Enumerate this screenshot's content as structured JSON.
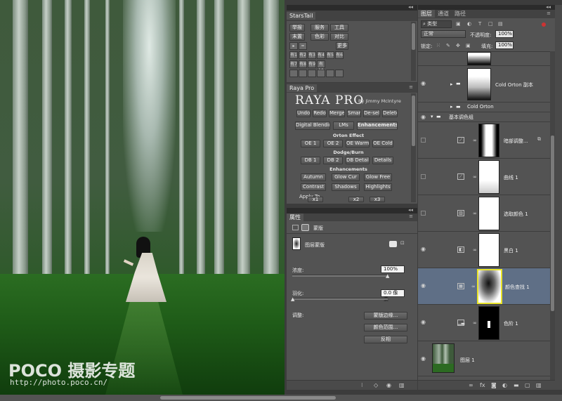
{
  "photo": {
    "watermark_logo": "POCO 摄影专题",
    "watermark_url": "http://photo.poco.cn/"
  },
  "starstail": {
    "title": "StarsTail",
    "row1": [
      "举报",
      "服务",
      "工具"
    ],
    "row2": [
      "末置",
      "色彩",
      "对比"
    ],
    "row3_more": "更多",
    "grid_labels": [
      "有1",
      "有2",
      "有3",
      "有4",
      "有5",
      "有6",
      "有7",
      "有8",
      "有9",
      "有10"
    ]
  },
  "raya": {
    "title": "Raya Pro",
    "logo": "RAYA PRO",
    "byline": "By Jimmy McIntyre",
    "row1": [
      "Undo",
      "Redo",
      "Merge",
      "Smart",
      "De-sel",
      "Delete"
    ],
    "tabs": [
      "Digital Blending",
      "LMs",
      "Enhancements"
    ],
    "section_orton": "Orton Effect",
    "orton_buttons": [
      "OE 1",
      "OE 2",
      "OE Warm",
      "OE Cold"
    ],
    "section_dodge": "Dodge/Burn",
    "dodge_buttons": [
      "DB 1",
      "DB 2",
      "DB Details",
      "Details"
    ],
    "section_enh": "Enhancements",
    "enh_row1": [
      "Autumn",
      "Glow Cur",
      "Glow Free"
    ],
    "enh_row2": [
      "Contrast",
      "Shadows",
      "Highlights"
    ],
    "apply_to": "Apply To",
    "apply_row": [
      "x1",
      "x2",
      "x3"
    ]
  },
  "properties": {
    "tab": "属性",
    "mask_type": "蒙版",
    "mask_label": "图层蒙版",
    "density_label": "浓度:",
    "density_value": "100%",
    "density_level": 1.0,
    "feather_label": "羽化:",
    "feather_value": "0.0 像素",
    "feather_level": 0.0,
    "refine_label": "调整:",
    "btn_edge": "蒙版边缘...",
    "btn_color_range": "颜色范围...",
    "btn_invert": "反相"
  },
  "layers": {
    "tabs": [
      "图层",
      "通道",
      "路径"
    ],
    "filter_kind": "类型",
    "blend_mode": "正常",
    "opacity_label": "不透明度:",
    "opacity_value": "100%",
    "lock_label": "锁定:",
    "fill_label": "填充:",
    "fill_value": "100%",
    "items": [
      {
        "name": "Cold Orton 副本",
        "type": "group"
      },
      {
        "name": "Cold Orton",
        "type": "group"
      },
      {
        "name": "基本调色组",
        "type": "group-open"
      },
      {
        "name": "暗部调整...",
        "type": "curves"
      },
      {
        "name": "曲线 1",
        "type": "curves"
      },
      {
        "name": "选取颜色 1",
        "type": "selective"
      },
      {
        "name": "黑白 1",
        "type": "bw"
      },
      {
        "name": "颜色查找 1",
        "type": "lookup",
        "selected": true
      },
      {
        "name": "色阶 1",
        "type": "levels"
      },
      {
        "name": "图层 1",
        "type": "pixel"
      }
    ]
  }
}
